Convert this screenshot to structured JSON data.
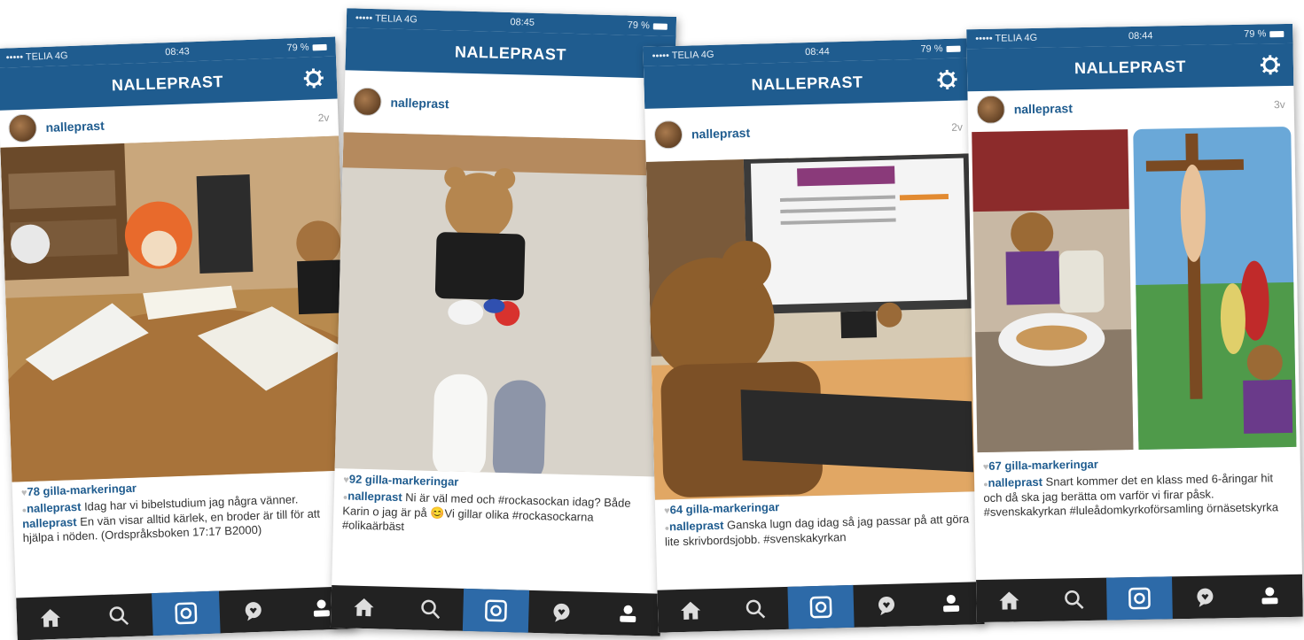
{
  "status": {
    "carrier": "••••• TELIA  4G",
    "battery": "79 %"
  },
  "app_title": "NALLEPRAST",
  "tabs": [
    "home",
    "search",
    "camera",
    "activity",
    "profile"
  ],
  "posts": [
    {
      "time": "08:43",
      "username": "nalleprast",
      "age": "2v",
      "likes": "78 gilla-markeringar",
      "caption_user": "nalleprast",
      "caption_text": "Idag har vi bibelstudium jag några vänner.",
      "comment_user": "nalleprast",
      "comment_text": "En vän visar alltid kärlek, en broder är till för att hjälpa i nöden. (Ordspråksboken 17:17 B2000)"
    },
    {
      "time": "08:45",
      "username": "nalleprast",
      "age": "",
      "likes": "92 gilla-markeringar",
      "caption_user": "nalleprast",
      "caption_text": "Ni är väl med och #rockasockan idag? Både Karin o jag är på 😊Vi gillar olika #rockasockarna #olikaärbäst"
    },
    {
      "time": "08:44",
      "username": "nalleprast",
      "age": "2v",
      "likes": "64 gilla-markeringar",
      "caption_user": "nalleprast",
      "caption_text": "Ganska lugn dag idag så jag passar på att göra lite skrivbordsjobb. #svenskakyrkan"
    },
    {
      "time": "08:44",
      "username": "nalleprast",
      "age": "3v",
      "likes": "67 gilla-markeringar",
      "caption_user": "nalleprast",
      "caption_text": "Snart kommer det en klass med 6-åringar hit och då ska jag berätta om varför vi firar påsk. #svenskakyrkan #luleådomkyrkoförsamling örnäsetskyrka"
    }
  ]
}
